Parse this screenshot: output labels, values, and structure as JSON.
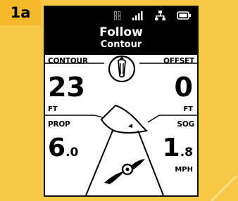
{
  "badge": {
    "label": "1a"
  },
  "header": {
    "title": "Follow",
    "subtitle": "Contour",
    "status_icons": [
      "gps-icon",
      "signal-bars-icon",
      "network-icon",
      "battery-icon"
    ]
  },
  "contour": {
    "label": "CONTOUR",
    "value": "23",
    "unit": "FT"
  },
  "offset": {
    "label": "OFFSET",
    "value": "0",
    "unit": "FT"
  },
  "prop": {
    "label": "PROP",
    "value_int": "6",
    "value_dec": ".0"
  },
  "sog": {
    "label": "SOG",
    "value_int": "1",
    "value_dec": ".8",
    "unit": "MPH"
  },
  "colors": {
    "accent": "#f7c846",
    "badge": "#f3b92b",
    "screen_bg": "#ffffff",
    "header_bg": "#000000"
  }
}
